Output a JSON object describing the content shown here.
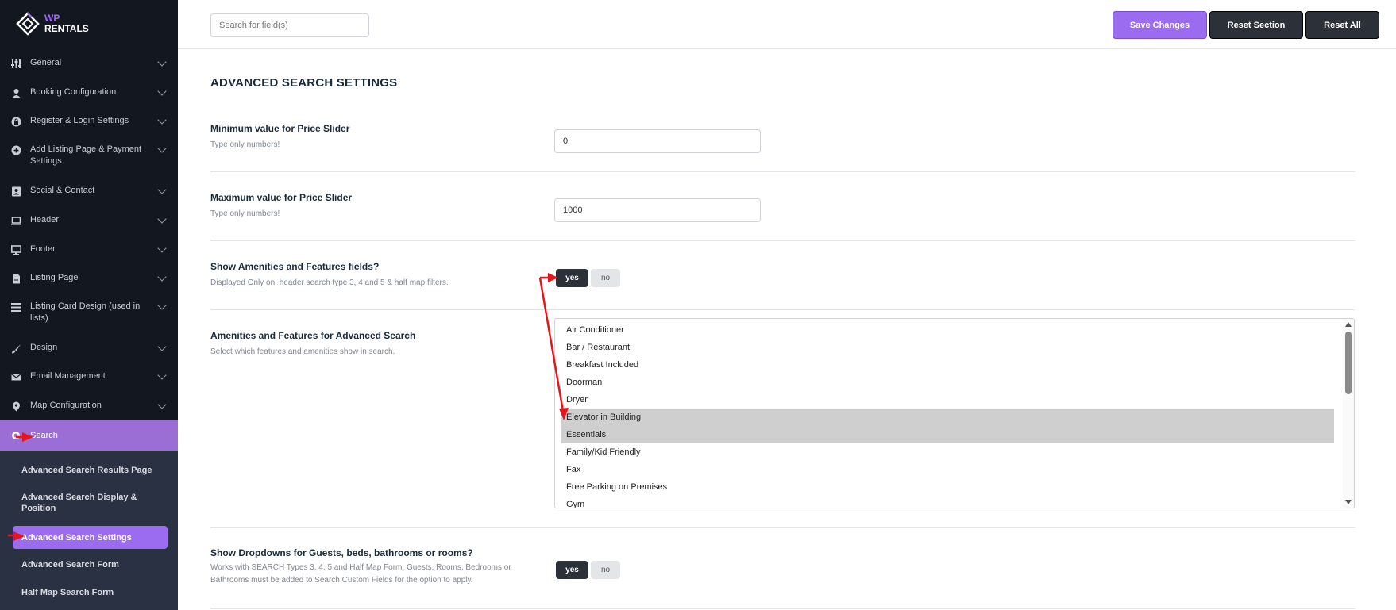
{
  "logo": {
    "wp": "WP",
    "rentals": "RENTALS"
  },
  "sidebar": {
    "items": [
      {
        "label": "General",
        "icon": "sliders-icon"
      },
      {
        "label": "Booking Configuration",
        "icon": "user-icon"
      },
      {
        "label": "Register & Login Settings",
        "icon": "lock-circle-icon"
      },
      {
        "label": "Add Listing Page & Payment Settings",
        "icon": "plus-circle-icon"
      },
      {
        "label": "Social & Contact",
        "icon": "contact-card-icon"
      },
      {
        "label": "Header",
        "icon": "laptop-icon"
      },
      {
        "label": "Footer",
        "icon": "monitor-icon"
      },
      {
        "label": "Listing Page",
        "icon": "document-icon"
      },
      {
        "label": "Listing Card Design (used in lists)",
        "icon": "list-icon"
      },
      {
        "label": "Design",
        "icon": "brush-icon"
      },
      {
        "label": "Email Management",
        "icon": "envelope-icon"
      },
      {
        "label": "Map Configuration",
        "icon": "map-pin-icon"
      },
      {
        "label": "Search",
        "icon": "search-icon"
      }
    ],
    "submenu": [
      {
        "label": "Advanced Search Results Page"
      },
      {
        "label": "Advanced Search Display & Position"
      },
      {
        "label": "Advanced Search Settings"
      },
      {
        "label": "Advanced Search Form"
      },
      {
        "label": "Half Map Search Form"
      }
    ]
  },
  "topbar": {
    "search_placeholder": "Search for field(s)",
    "save_label": "Save Changes",
    "reset_section_label": "Reset Section",
    "reset_all_label": "Reset All"
  },
  "main": {
    "title": "ADVANCED SEARCH SETTINGS",
    "min_price": {
      "title": "Minimum value for Price Slider",
      "desc": "Type only numbers!",
      "value": "0"
    },
    "max_price": {
      "title": "Maximum value for Price Slider",
      "desc": "Type only numbers!",
      "value": "1000"
    },
    "show_amenities": {
      "title": "Show Amenities and Features fields?",
      "desc": "Displayed Only on: header search type 3, 4 and 5 & half map filters.",
      "yes": "yes",
      "no": "no",
      "selected": "yes"
    },
    "amenities": {
      "title": "Amenities and Features for Advanced Search",
      "desc": "Select which features and amenities show in search.",
      "options": [
        {
          "label": "Air Conditioner",
          "selected": false
        },
        {
          "label": "Bar / Restaurant",
          "selected": false
        },
        {
          "label": "Breakfast Included",
          "selected": false
        },
        {
          "label": "Doorman",
          "selected": false
        },
        {
          "label": "Dryer",
          "selected": false
        },
        {
          "label": "Elevator in Building",
          "selected": true
        },
        {
          "label": "Essentials",
          "selected": true
        },
        {
          "label": "Family/Kid Friendly",
          "selected": false
        },
        {
          "label": "Fax",
          "selected": false
        },
        {
          "label": "Free Parking on Premises",
          "selected": false
        },
        {
          "label": "Gym",
          "selected": false
        }
      ]
    },
    "show_dropdowns": {
      "title": "Show Dropdowns for Guests, beds, bathrooms or rooms?",
      "desc": "Works with SEARCH Types 3, 4, 5 and Half Map Form. Guests, Rooms, Bedrooms or Bathrooms must be added to Search Custom Fields for the option to apply.",
      "yes": "yes",
      "no": "no",
      "selected": "yes"
    }
  },
  "colors": {
    "accent": "#9b6cf0",
    "sidebar_bg": "#13171f",
    "submenu_bg": "#2a3142",
    "annotation": "#e8141b"
  }
}
